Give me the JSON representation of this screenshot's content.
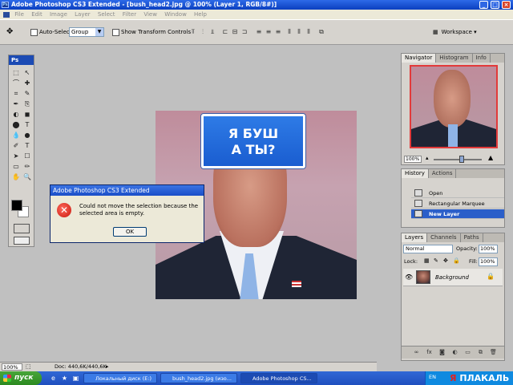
{
  "window": {
    "title": "Adobe Photoshop CS3 Extended - [bush_head2.jpg @ 100% (Layer 1, RGB/8#)]",
    "icon_text": "Ps",
    "controls": {
      "minimize": "_",
      "maximize": "□",
      "close": "×"
    }
  },
  "menu": [
    "File",
    "Edit",
    "Image",
    "Layer",
    "Select",
    "Filter",
    "View",
    "Window",
    "Help"
  ],
  "options_bar": {
    "auto_select_label": "Auto-Select:",
    "auto_select_value": "Group",
    "transform_label": "Show Transform Controls",
    "workspace_label": "Workspace ▾"
  },
  "toolbox": {
    "header": "Ps",
    "tools": [
      "⬚",
      "↖",
      "⌒",
      "✚",
      "⌗",
      "✎",
      "✒",
      "⎘",
      "◐",
      "◼",
      "⬤",
      "T",
      "✐",
      "☐",
      "✋",
      "🔍"
    ]
  },
  "canvas": {
    "sign_text_line1": "Я БУШ",
    "sign_text_line2": "А ТЫ?"
  },
  "dialog": {
    "title": "Adobe Photoshop CS3 Extended",
    "message": "Could not move the selection because the selected area is empty.",
    "ok_label": "OK",
    "icon_glyph": "✕"
  },
  "navigator": {
    "tabs": [
      "Navigator",
      "Histogram",
      "Info"
    ],
    "zoom": "100%"
  },
  "history": {
    "tabs": [
      "History",
      "Actions"
    ],
    "items": [
      {
        "label": "Open",
        "selected": false
      },
      {
        "label": "Rectangular Marquee",
        "selected": false
      },
      {
        "label": "New Layer",
        "selected": true
      }
    ]
  },
  "layers": {
    "tabs": [
      "Layers",
      "Channels",
      "Paths"
    ],
    "blend_mode": "Normal",
    "opacity_label": "Opacity:",
    "opacity": "100%",
    "lock_label": "Lock:",
    "fill_label": "Fill:",
    "fill": "100%",
    "layer_name": "Background",
    "footer_icons": [
      "link",
      "fx",
      "mask",
      "adjust",
      "group",
      "new",
      "trash"
    ]
  },
  "status_bar": {
    "zoom": "100%",
    "doc": "Doc: 440,6K/440,6K"
  },
  "taskbar": {
    "start_label": "пуск",
    "buttons": [
      {
        "label": "Локальный диск (E:)",
        "active": false
      },
      {
        "label": "bush_head2.jpg (изо...",
        "active": false
      },
      {
        "label": "Adobe Photoshop CS...",
        "active": true
      }
    ],
    "tray_lang": "EN",
    "tray_logo_prefix": "Я",
    "tray_logo_text": "ПЛАКАЛЬ"
  },
  "colors": {
    "title_bar": "#0b3fbf",
    "dialog_error": "#c8150a",
    "sign_blue": "#1a5dd0",
    "history_selected": "#2b5fc9"
  }
}
